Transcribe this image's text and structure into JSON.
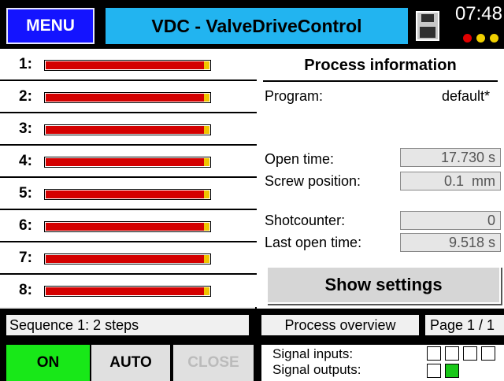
{
  "header": {
    "menu_label": "MENU",
    "title": "VDC - ValveDriveControl",
    "time": "07:48",
    "save_icon": "floppy-disk-icon",
    "dot_colors": [
      "#e00000",
      "#f0d000",
      "#f0d000"
    ]
  },
  "valves": [
    {
      "label": "1:",
      "level": 1.0
    },
    {
      "label": "2:",
      "level": 1.0
    },
    {
      "label": "3:",
      "level": 1.0
    },
    {
      "label": "4:",
      "level": 1.0
    },
    {
      "label": "5:",
      "level": 1.0
    },
    {
      "label": "6:",
      "level": 1.0
    },
    {
      "label": "7:",
      "level": 1.0
    },
    {
      "label": "8:",
      "level": 1.0
    }
  ],
  "process": {
    "title": "Process information",
    "program_label": "Program:",
    "program_value": "default*",
    "open_time_label": "Open time:",
    "open_time_value": "17.730 s",
    "screw_label": "Screw position:",
    "screw_value": "0.1  mm",
    "shotcounter_label": "Shotcounter:",
    "shotcounter_value": "0",
    "last_open_label": "Last open time:",
    "last_open_value": "9.518 s",
    "settings_button": "Show settings"
  },
  "status": {
    "sequence": "Sequence 1: 2 steps",
    "overview": "Process overview",
    "page": "Page 1 / 1"
  },
  "controls": {
    "on": "ON",
    "auto": "AUTO",
    "close": "CLOSE"
  },
  "signals": {
    "inputs_label": "Signal inputs:",
    "outputs_label": "Signal outputs:",
    "inputs": [
      false,
      false,
      false,
      false
    ],
    "outputs": [
      false,
      true
    ],
    "active_color": "#18c818"
  }
}
